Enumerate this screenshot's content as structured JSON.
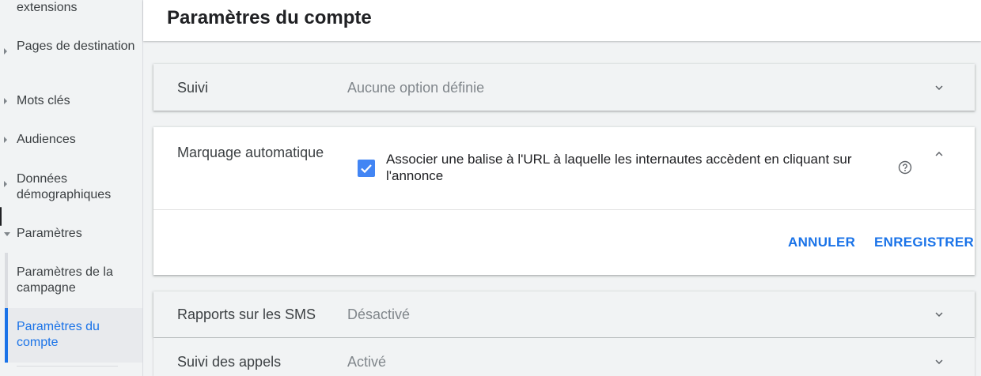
{
  "sidebar": {
    "items": [
      {
        "label": "extensions"
      },
      {
        "label": "Pages de destination"
      },
      {
        "label": "Mots clés"
      },
      {
        "label": "Audiences"
      },
      {
        "label": "Données démographiques"
      },
      {
        "label": "Paramètres"
      }
    ],
    "sub_items": [
      {
        "label": "Paramètres de la campagne"
      },
      {
        "label": "Paramètres du compte",
        "active": true
      }
    ]
  },
  "header": {
    "title": "Paramètres du compte"
  },
  "sections": [
    {
      "label": "Suivi",
      "value": "Aucune option définie"
    },
    {
      "label": "Marquage automatique",
      "checkbox_label": "Associer une balise à l'URL à laquelle les internautes accèdent en cliquant sur l'annonce",
      "checked": true,
      "cancel_label": "ANNULER",
      "save_label": "ENREGISTRER"
    },
    {
      "label": "Rapports sur les SMS",
      "value": "Désactivé"
    },
    {
      "label": "Suivi des appels",
      "value": "Activé"
    }
  ],
  "colors": {
    "accent": "#1a73e8",
    "checkbox": "#4285f4"
  },
  "icons": [
    "chevron-down-icon",
    "chevron-up-icon",
    "help-icon",
    "check-icon",
    "caret-right-icon",
    "caret-down-icon"
  ]
}
